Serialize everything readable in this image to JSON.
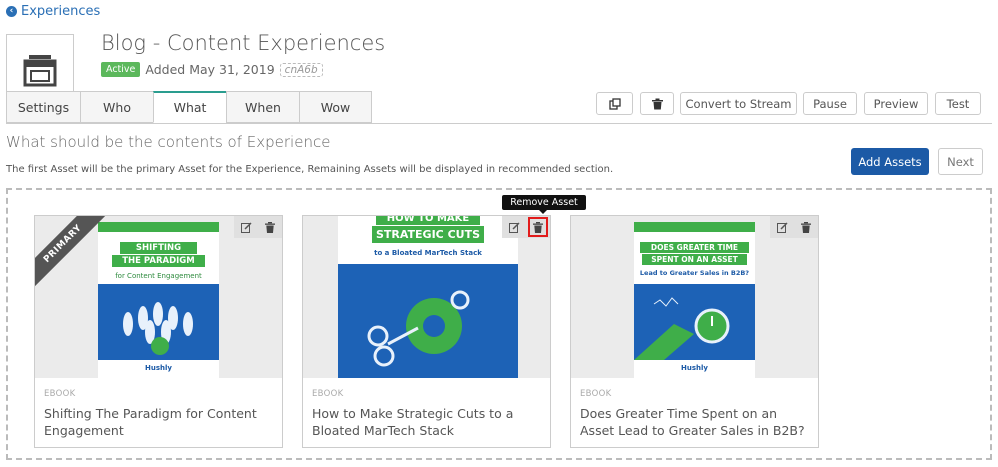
{
  "nav": {
    "back_label": "Experiences"
  },
  "header": {
    "title": "Blog - Content Experiences",
    "status": "Active",
    "added": "Added May 31, 2019",
    "code": "cnA6b"
  },
  "tabs": [
    {
      "label": "Settings",
      "active": false
    },
    {
      "label": "Who",
      "active": false
    },
    {
      "label": "What",
      "active": true
    },
    {
      "label": "When",
      "active": false
    },
    {
      "label": "Wow",
      "active": false
    }
  ],
  "toolbar": {
    "copy_icon": "copy-icon",
    "delete_icon": "trash-icon",
    "convert_label": "Convert to Stream",
    "pause_label": "Pause",
    "preview_label": "Preview",
    "test_label": "Test"
  },
  "section": {
    "title": "What should be the contents of Experience",
    "description": "The first Asset will be the primary Asset for the Experience, Remaining Assets will be displayed in recommended section.",
    "add_label": "Add Assets",
    "next_label": "Next"
  },
  "tooltip": "Remove Asset",
  "colors": {
    "accent": "#1c5aa6",
    "active_badge": "#5cb85c",
    "highlight": "#e21b1b"
  },
  "assets": [
    {
      "type": "EBOOK",
      "title": "Shifting The Paradigm for Content Engagement",
      "primary_label": "PRIMARY",
      "cover": {
        "line1": "SHIFTING",
        "line2": "THE PARADIGM",
        "sub": "for Content Engagement",
        "foot": "Hushly"
      }
    },
    {
      "type": "EBOOK",
      "title": "How to Make Strategic Cuts to a Bloated MarTech Stack",
      "cover": {
        "line1": "HOW TO MAKE",
        "line2": "STRATEGIC CUTS",
        "sub": "to a Bloated MarTech Stack"
      }
    },
    {
      "type": "EBOOK",
      "title": "Does Greater Time Spent on an Asset Lead to Greater Sales in B2B?",
      "cover": {
        "line1": "DOES GREATER TIME",
        "line2": "SPENT ON AN ASSET",
        "sub": "Lead to Greater Sales in B2B?",
        "foot": "Hushly"
      }
    }
  ]
}
